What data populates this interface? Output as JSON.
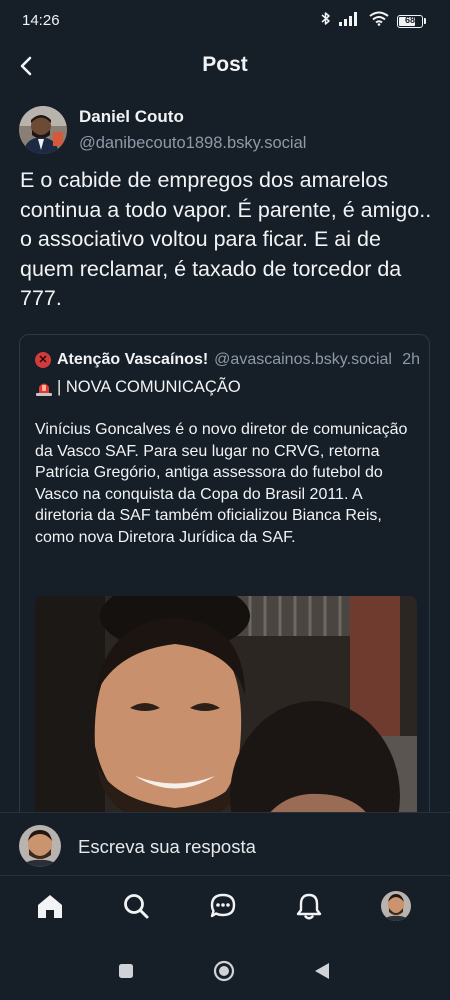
{
  "status_bar": {
    "time": "14:26",
    "battery": "68"
  },
  "header": {
    "title": "Post"
  },
  "post": {
    "author_name": "Daniel Couto",
    "author_handle": "@danibecouto1898.bsky.social",
    "text": "E o cabide de empregos dos amarelos continua a todo vapor. É parente, é amigo.. o associativo voltou para ficar. E ai de quem reclamar, é taxado de torcedor da 777."
  },
  "quote": {
    "author_name": "Atenção Vascaínos!",
    "author_handle": "@avascainos.bsky.social",
    "time": "2h",
    "headline": "| NOVA COMUNICAÇÃO",
    "text": "Vinícius Goncalves é o novo diretor de comunicação da Vasco SAF. Para seu lugar no CRVG, retorna Patrícia Gregório, antiga assessora do futebol do Vasco na conquista da Copa do Brasil 2011. A diretoria da SAF também oficializou Bianca Reis, como nova Diretora Jurídica da SAF."
  },
  "reply": {
    "placeholder": "Escreva sua resposta"
  },
  "nav": {
    "items": [
      "home-icon",
      "search-icon",
      "chat-icon",
      "bell-icon",
      "profile-avatar"
    ]
  },
  "colors": {
    "background": "#161e27",
    "text": "#f1f3f5",
    "muted": "#8d9aa8",
    "border": "#2c3845",
    "badge": "#d23b3b"
  }
}
